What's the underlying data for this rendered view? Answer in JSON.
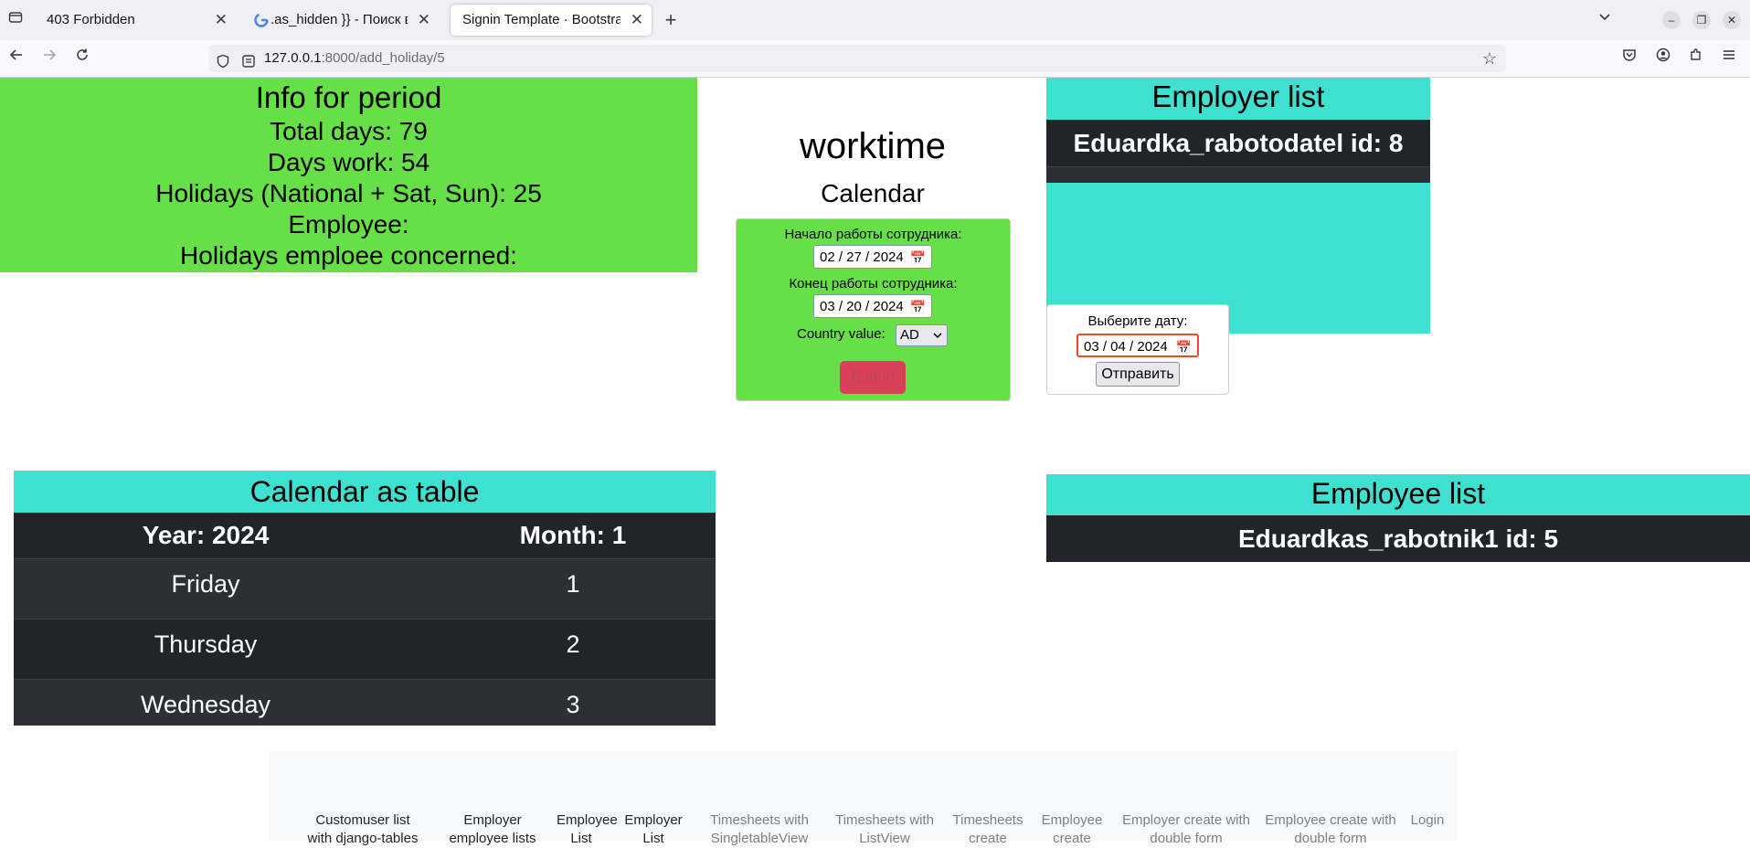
{
  "browser": {
    "tabs": [
      {
        "label": "403 Forbidden",
        "active": false
      },
      {
        "label": ".as_hidden }} - Поиск в Google",
        "active": false
      },
      {
        "label": "Signin Template · Bootstrap",
        "active": true
      }
    ],
    "url_host": "127.0.0.1",
    "url_path": ":8000/add_holiday/5"
  },
  "info": {
    "title": "Info for period",
    "total_days": "Total days: 79",
    "days_work": "Days work: 54",
    "holidays": "Holidays (National + Sat, Sun): 25",
    "employee": "Employee:",
    "holidays_employee": "Holidays emploee concerned:"
  },
  "brand": "worktime",
  "calendar_heading": "Calendar",
  "period_form": {
    "start_label": "Начало работы сотрудника:",
    "start_value": "02 / 27 / 2024",
    "end_label": "Конец работы сотрудника:",
    "end_value": "03 / 20 / 2024",
    "country_label": "Country value:",
    "country_value": "AD",
    "submit_label": "Button"
  },
  "employer_list": {
    "title": "Employer list",
    "rows": [
      "Eduardka_rabotodatel id: 8"
    ]
  },
  "date_form": {
    "label": "Выберите дату:",
    "value": "03 / 04 / 2024",
    "submit_label": "Отправить"
  },
  "calendar_table": {
    "title": "Calendar as table",
    "header_year": "Year: 2024",
    "header_month": "Month: 1",
    "rows": [
      {
        "day": "Friday",
        "num": "1"
      },
      {
        "day": "Thursday",
        "num": "2"
      },
      {
        "day": "Wednesday",
        "num": "3"
      }
    ]
  },
  "employee_list": {
    "title": "Employee list",
    "rows": [
      "Eduardkas_rabotnik1 id: 5"
    ]
  },
  "footer_nav": [
    "Customuser list with django-tables",
    "Employer employee lists",
    "Employee List",
    "Employer List",
    "Timesheets with SingletableView",
    "Timesheets with ListView",
    "Timesheets create",
    "Employee create",
    "Employer create with double form",
    "Employee create with double form",
    "Login"
  ]
}
